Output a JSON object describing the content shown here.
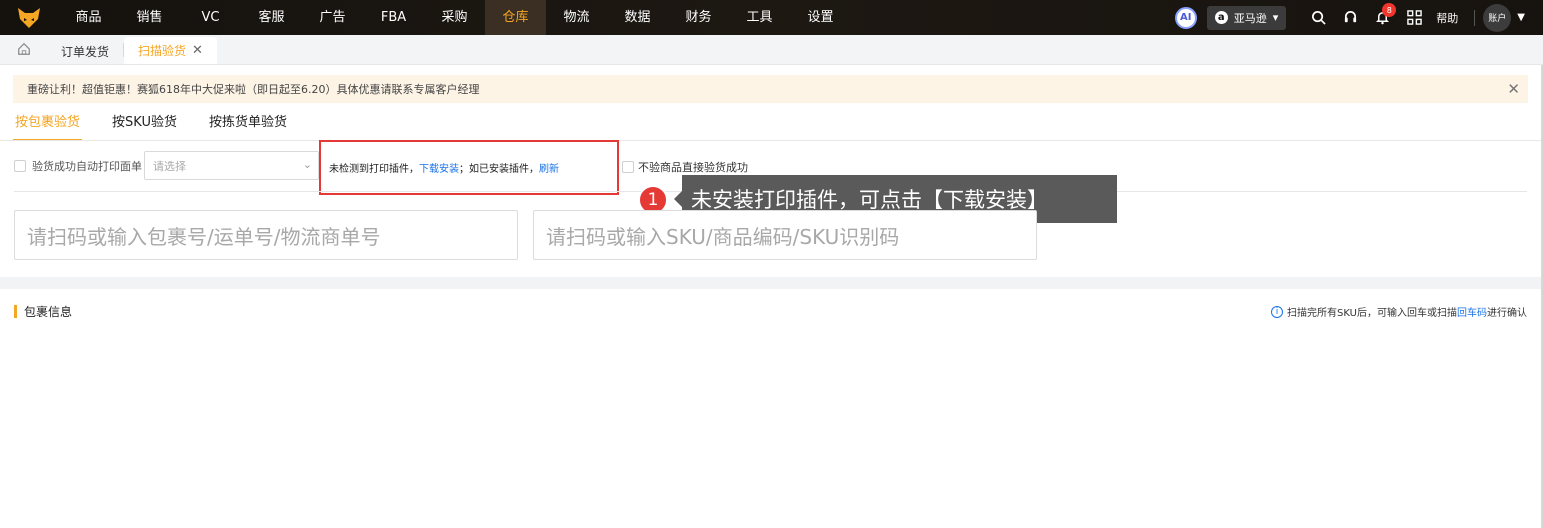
{
  "nav": {
    "items": [
      "商品",
      "销售",
      "VC",
      "客服",
      "广告",
      "FBA",
      "采购",
      "仓库",
      "物流",
      "数据",
      "财务",
      "工具",
      "设置"
    ],
    "active_index": 7
  },
  "top_right": {
    "ai_label": "AI",
    "store_label": "亚马逊",
    "notification_count": "8",
    "help_label": "帮助",
    "account_label": "账户"
  },
  "tabs": {
    "items": [
      {
        "label": "订单发货"
      },
      {
        "label": "扫描验货"
      }
    ],
    "close_glyph": "✕"
  },
  "notice": {
    "text": "重磅让利！超值钜惠！赛狐618年中大促来啦（即日起至6.20）具体优惠请联系专属客户经理"
  },
  "mode_tabs": [
    "按包裹验货",
    "按SKU验货",
    "按拣货单验货"
  ],
  "options": {
    "auto_print_label": "验货成功自动打印面单",
    "select_placeholder": "请选择",
    "plugin_text_1": "未检测到打印插件，",
    "plugin_link_download": "下载安装",
    "plugin_text_2": "；如已安装插件，",
    "plugin_link_refresh": "刷新",
    "no_verify_label": "不验商品直接验货成功"
  },
  "tooltip": {
    "step": "1",
    "text": "未安装打印插件，可点击【下载安装】"
  },
  "inputs": {
    "package_placeholder": "请扫码或输入包裹号/运单号/物流商单号",
    "sku_placeholder": "请扫码或输入SKU/商品编码/SKU识别码"
  },
  "package_section": {
    "title": "包裹信息",
    "hint_prefix": "扫描完所有SKU后，可输入回车或扫描",
    "hint_link": "回车码",
    "hint_suffix": "进行确认"
  },
  "colors": {
    "accent": "#f5a623",
    "link": "#1a73e8",
    "highlight_border": "#e53935"
  }
}
